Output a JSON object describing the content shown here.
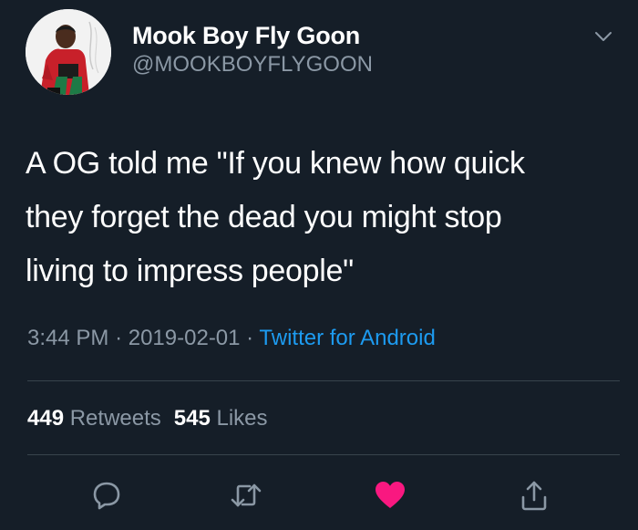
{
  "user": {
    "display_name": "Mook Boy Fly Goon",
    "handle": "@MOOKBOYFLYGOON"
  },
  "tweet": {
    "lines": [
      "A OG told me \"If you knew how quick",
      "they forget the dead you might stop",
      "living to impress people\""
    ],
    "time": "3:44 PM",
    "separator": "·",
    "date": "2019-02-01",
    "source": "Twitter for Android"
  },
  "stats": {
    "retweets_count": "449",
    "retweets_label": "Retweets",
    "likes_count": "545",
    "likes_label": "Likes"
  },
  "actions": {
    "reply_icon": "reply-icon",
    "retweet_icon": "retweet-icon",
    "like_icon": "heart-icon",
    "share_icon": "share-icon"
  },
  "colors": {
    "background": "#151e28",
    "secondary_text": "#8b98a5",
    "link": "#1d9bf0",
    "like": "#f91880",
    "divider": "#38444d"
  }
}
